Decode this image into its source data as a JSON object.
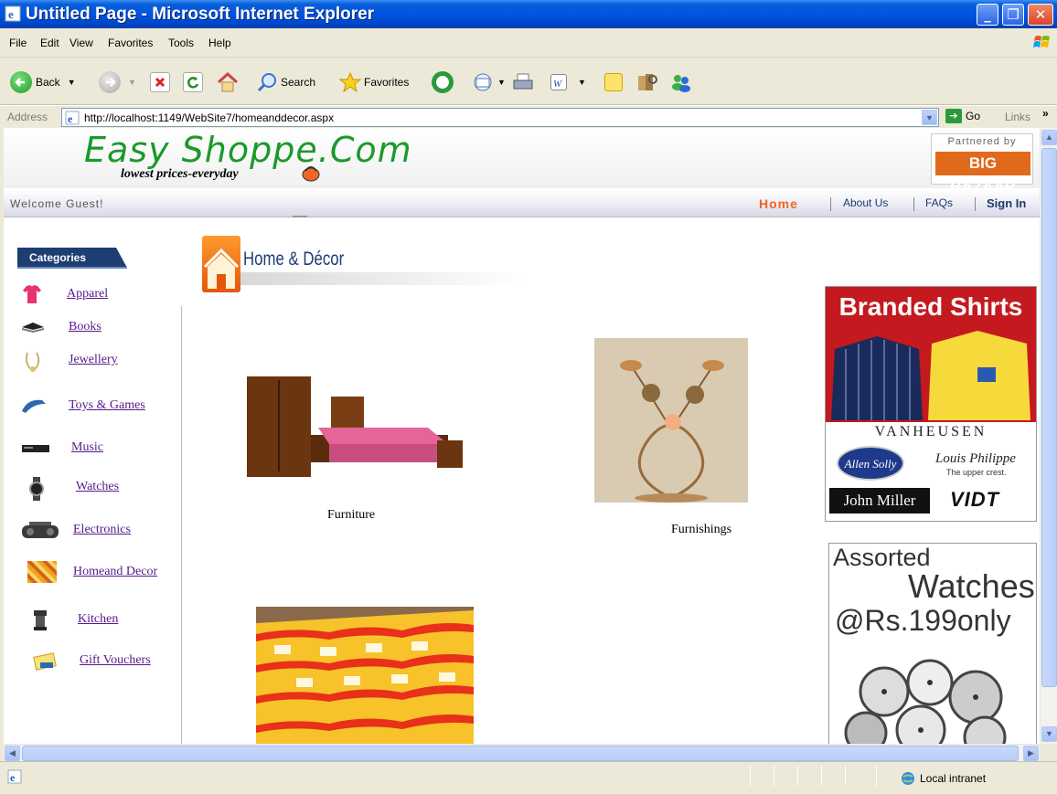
{
  "window": {
    "title": "Untitled Page - Microsoft Internet Explorer"
  },
  "menu": [
    "File",
    "Edit",
    "View",
    "Favorites",
    "Tools",
    "Help"
  ],
  "toolbar": {
    "back": "Back",
    "search": "Search",
    "favorites": "Favorites"
  },
  "address": {
    "label": "Address",
    "url": "http://localhost:1149/WebSite7/homeanddecor.aspx",
    "go": "Go",
    "links": "Links"
  },
  "status": {
    "zone": "Local intranet"
  },
  "site": {
    "logo": "Easy Shoppe.Com",
    "tagline": "lowest prices-everyday",
    "partner_caption": "Partnered by",
    "partner_name": "BIG BAZAAR",
    "welcome": "Welcome Guest!",
    "nav": {
      "home": "Home",
      "about": "About Us",
      "faqs": "FAQs",
      "signin": "Sign In"
    },
    "categories_title": "Categories",
    "categories": [
      "Apparel",
      "Books",
      "Jewellery",
      "Toys & Games",
      "Music",
      "Watches",
      "Electronics",
      "Homeand Decor",
      "Kitchen",
      "Gift Vouchers"
    ],
    "section_title": "Home & Décor",
    "products": [
      "Furniture",
      "Furnishings"
    ],
    "ad_shirts": {
      "title": "Branded Shirts",
      "brand1": "VANHEUSEN",
      "brand2": "Allen Solly",
      "brand3": "Louis Philippe",
      "brand3_tag": "The upper crest.",
      "brand4": "John Miller",
      "brand5": "VIDT"
    },
    "ad_watches": {
      "line1": "Assorted",
      "line2": "Watches",
      "line3": "@Rs.199only"
    }
  },
  "colors": {
    "title_bar": "#0054e3",
    "logo_green": "#1a9a2a",
    "nav_orange": "#f26522",
    "link_purple": "#551a8b"
  }
}
